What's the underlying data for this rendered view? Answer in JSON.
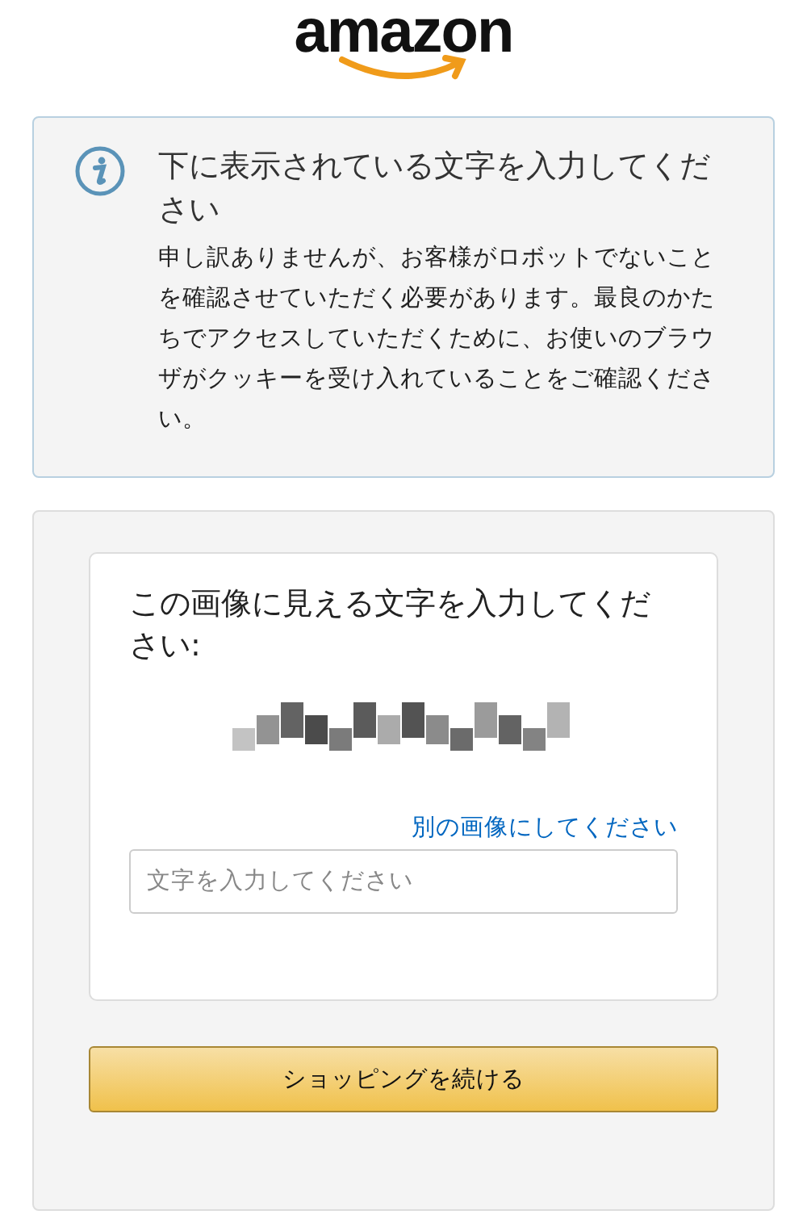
{
  "logo": {
    "text": "amazon"
  },
  "alert": {
    "title": "下に表示されている文字を入力してください",
    "body": "申し訳ありませんが、お客様がロボットでないことを確認させていただく必要があります。最良のかたちでアクセスしていただくために、お使いのブラウザがクッキーを受け入れていることをご確認ください。"
  },
  "captcha": {
    "heading": "この画像に見える文字を入力してください:",
    "refresh_link": "別の画像にしてください",
    "input": {
      "placeholder": "文字を入力してください"
    }
  },
  "button": {
    "label": "ショッピングを続ける"
  }
}
